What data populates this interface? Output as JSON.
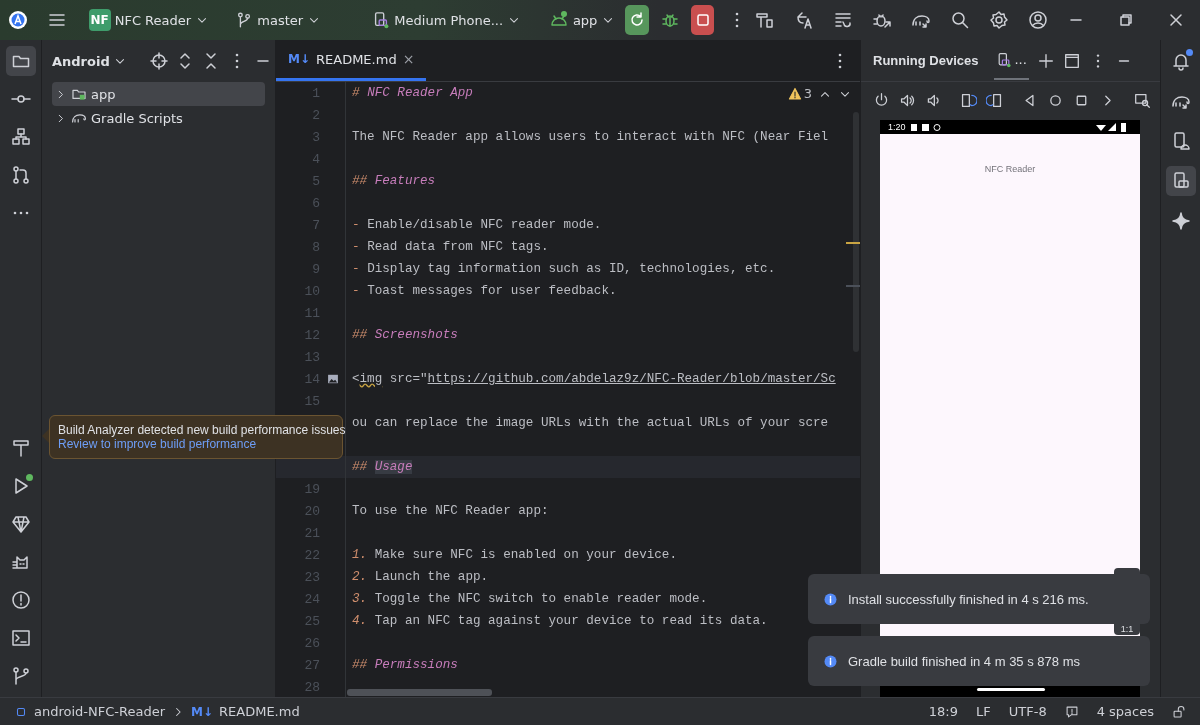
{
  "title_bar": {
    "project_badge": "NF",
    "project": "NFC Reader",
    "branch": "master",
    "device": "Medium Phone...",
    "run_config": "app"
  },
  "left_strip": {
    "top": [
      {
        "selected": true
      },
      {
        "selected": false
      },
      {
        "selected": false
      },
      {
        "selected": false
      },
      {
        "selected": false
      }
    ],
    "bottom": [
      {
        "selected": false,
        "dot": false
      },
      {
        "selected": false,
        "dot": true
      },
      {
        "selected": false,
        "dot": false
      },
      {
        "selected": false,
        "dot": false
      },
      {
        "selected": false,
        "dot": false
      },
      {
        "selected": false,
        "dot": false
      },
      {
        "selected": false,
        "dot": false
      }
    ]
  },
  "project_panel": {
    "view": "Android",
    "tree": [
      {
        "label": "app",
        "kind": "module",
        "selected": true,
        "expanded": false
      },
      {
        "label": "Gradle Scripts",
        "kind": "gradle",
        "selected": false,
        "expanded": false
      }
    ]
  },
  "editor": {
    "tabs": [
      {
        "icon_text": "M↓",
        "label": "README.md",
        "close_glyph": "×",
        "selected": true
      }
    ],
    "warnings": "3",
    "lines": [
      {
        "n": "1",
        "current": false,
        "segs": [
          {
            "kind": "mark",
            "text": "# "
          },
          {
            "kind": "heading",
            "text": "NFC Reader App"
          }
        ]
      },
      {
        "n": "2",
        "current": false
      },
      {
        "n": "3",
        "current": false,
        "segs": [
          {
            "kind": "plain",
            "text": "The NFC Reader app allows users to interact with NFC (Near Fiel"
          }
        ]
      },
      {
        "n": "4",
        "current": false
      },
      {
        "n": "5",
        "current": false,
        "segs": [
          {
            "kind": "mark",
            "text": "## "
          },
          {
            "kind": "heading",
            "text": "Features"
          }
        ]
      },
      {
        "n": "6",
        "current": false
      },
      {
        "n": "7",
        "current": false,
        "segs": [
          {
            "kind": "mark",
            "text": "- "
          },
          {
            "kind": "plain",
            "text": "Enable/disable NFC reader mode."
          }
        ]
      },
      {
        "n": "8",
        "current": false,
        "segs": [
          {
            "kind": "mark",
            "text": "- "
          },
          {
            "kind": "plain",
            "text": "Read data from NFC tags."
          }
        ]
      },
      {
        "n": "9",
        "current": false,
        "segs": [
          {
            "kind": "mark",
            "text": "- "
          },
          {
            "kind": "plain",
            "text": "Display tag information such as ID, technologies, etc."
          }
        ]
      },
      {
        "n": "10",
        "current": false,
        "segs": [
          {
            "kind": "mark",
            "text": "- "
          },
          {
            "kind": "plain",
            "text": "Toast messages for user feedback."
          }
        ]
      },
      {
        "n": "11",
        "current": false
      },
      {
        "n": "12",
        "current": false,
        "segs": [
          {
            "kind": "mark",
            "text": "## "
          },
          {
            "kind": "heading",
            "text": "Screenshots"
          }
        ]
      },
      {
        "n": "13",
        "current": false
      },
      {
        "n": "14",
        "current": false,
        "image": true,
        "segs": [
          {
            "kind": "plain",
            "text": "<"
          },
          {
            "kind": "warn",
            "text": "img"
          },
          {
            "kind": "plain",
            "text": " src=\""
          },
          {
            "kind": "url",
            "text": "https://github.com/abdelaz9z/NFC-Reader/blob/master/Sc"
          }
        ]
      },
      {
        "n": "15",
        "current": false
      },
      {
        "current": false,
        "segs": [
          {
            "kind": "plain",
            "text": "ou can replace the image URLs with the actual URLs of your scre"
          }
        ]
      },
      {
        "current": false
      },
      {
        "current": true,
        "segs": [
          {
            "kind": "mark",
            "text": "## "
          },
          {
            "kind": "highlight",
            "text": "Usage"
          }
        ]
      },
      {
        "n": "19",
        "current": false
      },
      {
        "n": "20",
        "current": false,
        "segs": [
          {
            "kind": "plain",
            "text": "To use the NFC Reader app:"
          }
        ]
      },
      {
        "n": "21",
        "current": false
      },
      {
        "n": "22",
        "current": false,
        "segs": [
          {
            "kind": "mark",
            "text": "1. "
          },
          {
            "kind": "plain",
            "text": "Make sure NFC is enabled on your device."
          }
        ]
      },
      {
        "n": "23",
        "current": false,
        "segs": [
          {
            "kind": "mark",
            "text": "2. "
          },
          {
            "kind": "plain",
            "text": "Launch the app."
          }
        ]
      },
      {
        "n": "24",
        "current": false,
        "segs": [
          {
            "kind": "mark",
            "text": "3. "
          },
          {
            "kind": "plain",
            "text": "Toggle the NFC switch to enable reader mode."
          }
        ]
      },
      {
        "n": "25",
        "current": false,
        "segs": [
          {
            "kind": "mark",
            "text": "4. "
          },
          {
            "kind": "plain",
            "text": "Tap an NFC tag against your device to read its data."
          }
        ]
      },
      {
        "n": "26",
        "current": false
      },
      {
        "n": "27",
        "current": false,
        "segs": [
          {
            "kind": "mark",
            "text": "## "
          },
          {
            "kind": "heading",
            "text": "Permissions"
          }
        ]
      },
      {
        "n": "28",
        "current": false
      }
    ]
  },
  "tooltip": {
    "message": "Build Analyzer detected new build performance issues",
    "link": "Review to improve build performance"
  },
  "running_devices": {
    "title": "Running Devices",
    "device_tab": "...",
    "phone": {
      "time": "1:20",
      "app_title": "NFC Reader",
      "zoom": "1:1"
    }
  },
  "notifications": [
    {
      "message": "Install successfully finished in 4 s 216 ms."
    },
    {
      "message": "Gradle build finished in 4 m 35 s 878 ms"
    }
  ],
  "right_strip": [
    {
      "selected": false,
      "dot": true
    },
    {
      "selected": false,
      "dot": false
    },
    {
      "selected": false,
      "dot": false
    },
    {
      "selected": true,
      "dot": false
    },
    {
      "selected": false,
      "dot": false
    }
  ],
  "status_bar": {
    "project": "android-NFC-Reader",
    "file_icon_text": "M↓",
    "file": "README.md",
    "position": "18:9",
    "line_separator": "LF",
    "encoding": "UTF-8",
    "indent": "4 spaces"
  }
}
